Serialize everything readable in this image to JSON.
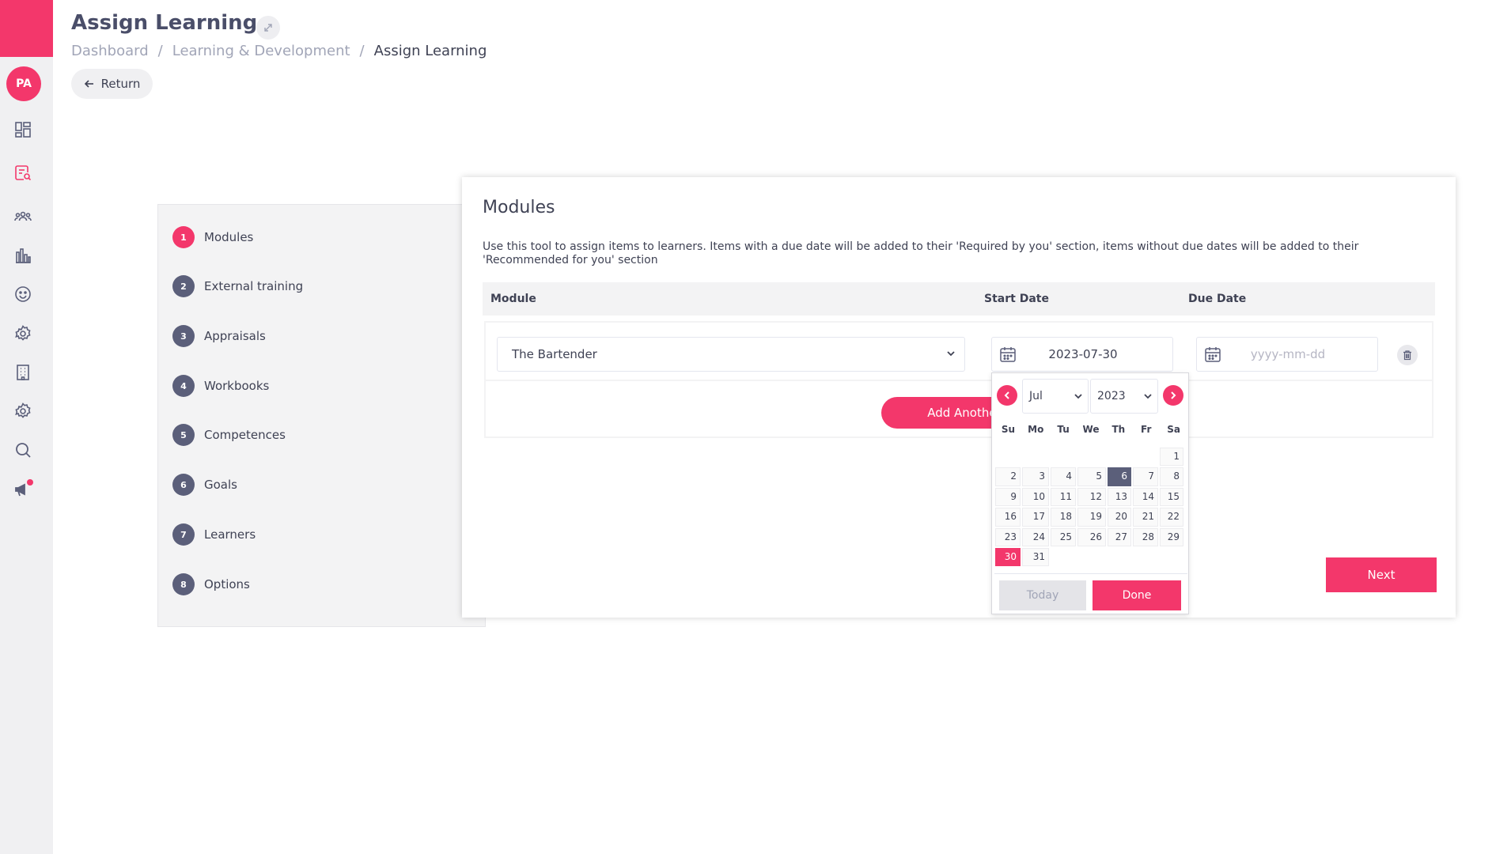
{
  "sidebar": {
    "avatar_initials": "PA",
    "icons": [
      "dashboard-icon",
      "learning-search-icon",
      "team-icon",
      "chart-icon",
      "smiley-icon",
      "settings-icon",
      "building-icon",
      "gear-icon",
      "search-icon",
      "megaphone-icon"
    ],
    "accent": "#f3376b"
  },
  "header": {
    "title": "Assign Learning",
    "breadcrumb": [
      "Dashboard",
      "Learning & Development",
      "Assign Learning"
    ],
    "return_label": "Return"
  },
  "steps": [
    {
      "num": "1",
      "label": "Modules"
    },
    {
      "num": "2",
      "label": "External training"
    },
    {
      "num": "3",
      "label": "Appraisals"
    },
    {
      "num": "4",
      "label": "Workbooks"
    },
    {
      "num": "5",
      "label": "Competences"
    },
    {
      "num": "6",
      "label": "Goals"
    },
    {
      "num": "7",
      "label": "Learners"
    },
    {
      "num": "8",
      "label": "Options"
    }
  ],
  "card": {
    "title": "Modules",
    "description": "Use this tool to assign items to learners. Items with a due date will be added to their 'Required by you' section, items without due dates will be added to their 'Recommended for you' section",
    "columns": {
      "module": "Module",
      "start": "Start Date",
      "due": "Due Date"
    },
    "row": {
      "module_value": "The Bartender",
      "start_date": "2023-07-30",
      "due_placeholder": "yyyy-mm-dd"
    },
    "add_label": "Add Another",
    "next_label": "Next"
  },
  "datepicker": {
    "month": "Jul",
    "year": "2023",
    "weekdays": [
      "Su",
      "Mo",
      "Tu",
      "We",
      "Th",
      "Fr",
      "Sa"
    ],
    "days": [
      "",
      "",
      "",
      "",
      "",
      "",
      "1",
      "2",
      "3",
      "4",
      "5",
      "6",
      "7",
      "8",
      "9",
      "10",
      "11",
      "12",
      "13",
      "14",
      "15",
      "16",
      "17",
      "18",
      "19",
      "20",
      "21",
      "22",
      "23",
      "24",
      "25",
      "26",
      "27",
      "28",
      "29",
      "30",
      "31"
    ],
    "highlighted_day": "6",
    "selected_day": "30",
    "today_label": "Today",
    "done_label": "Done"
  }
}
